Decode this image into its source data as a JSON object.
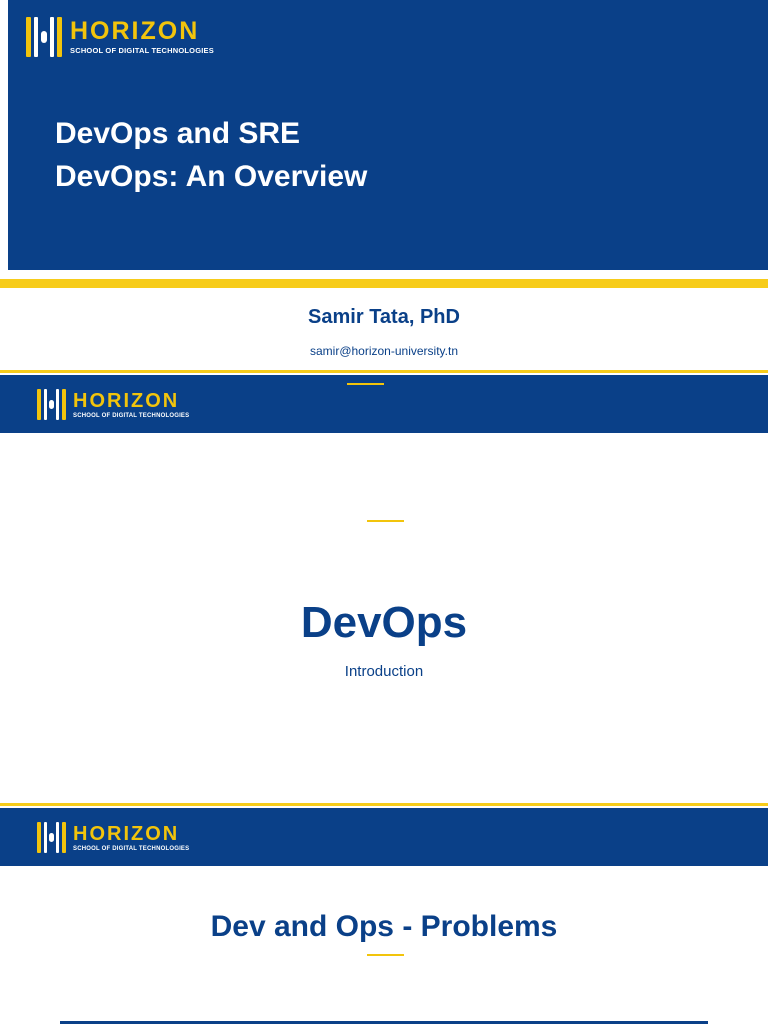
{
  "brand": {
    "name": "HORIZON",
    "tagline": "SCHOOL OF DIGITAL TECHNOLOGIES",
    "yellow": "#F7CC1A",
    "navy": "#0A4088"
  },
  "slide1": {
    "title_line1": "DevOps and SRE",
    "title_line2": "DevOps: An Overview",
    "author": "Samir Tata, PhD",
    "email": "samir@horizon-university.tn"
  },
  "slide2": {
    "title": "DevOps",
    "subtitle": "Introduction"
  },
  "slide3": {
    "title": "Dev and Ops - Problems"
  }
}
